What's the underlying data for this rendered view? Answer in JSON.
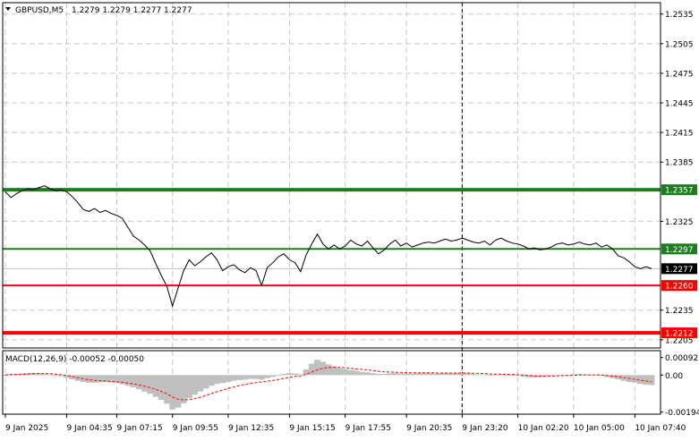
{
  "header": {
    "symbol_label": "GBPUSD,M5",
    "ohlc_label": "1.2279 1.2279 1.2277 1.2277"
  },
  "macd_panel": {
    "label": "MACD(12,26,9) -0.00052 -0.00050"
  },
  "colors": {
    "background": "#ffffff",
    "price_line": "#000000",
    "grid": "#c8c8c8",
    "green_level": "#1e7d1e",
    "red_level": "#ff0000",
    "histogram": "#c0c0c0",
    "signal_line": "#ff0000"
  },
  "chart_data": [
    {
      "type": "line",
      "title": "GBPUSD,M5",
      "y_ticks": [
        "1.2535",
        "1.2505",
        "1.2475",
        "1.2445",
        "1.2415",
        "1.2385",
        "1.2325",
        "1.2235",
        "1.2205"
      ],
      "ylim": [
        1.2203,
        1.2542
      ],
      "grid": "dashed",
      "x_ticks": [
        {
          "label": "9 Jan 2025",
          "i": 0
        },
        {
          "label": "9 Jan 04:35",
          "i": 11
        },
        {
          "label": "9 Jan 07:15",
          "i": 20
        },
        {
          "label": "9 Jan 09:55",
          "i": 30
        },
        {
          "label": "9 Jan 12:35",
          "i": 40
        },
        {
          "label": "9 Jan 15:15",
          "i": 51
        },
        {
          "label": "9 Jan 17:55",
          "i": 61
        },
        {
          "label": "9 Jan 20:35",
          "i": 72
        },
        {
          "label": "9 Jan 23:20",
          "i": 82
        },
        {
          "label": "10 Jan 02:20",
          "i": 92
        },
        {
          "label": "10 Jan 05:00",
          "i": 102
        },
        {
          "label": "10 Jan 07:40",
          "i": 113
        }
      ],
      "vline_at_i": 82,
      "levels": [
        {
          "value": 1.2357,
          "label": "1.2357",
          "color": "#1e7d1e",
          "thick": true
        },
        {
          "value": 1.2297,
          "label": "1.2297",
          "color": "#1e7d1e",
          "thick": false
        },
        {
          "value": 1.226,
          "label": "1.2260",
          "color": "#ff0000",
          "thick": false
        },
        {
          "value": 1.2212,
          "label": "1.2212",
          "color": "#ff0000",
          "thick": true
        }
      ],
      "current": {
        "value": 1.2277,
        "label": "1.2277"
      },
      "series": [
        {
          "values": [
            1.2355,
            1.2349,
            1.2353,
            1.2356,
            1.2358,
            1.2357,
            1.2359,
            1.2361,
            1.2358,
            1.2356,
            1.2357,
            1.2355,
            1.235,
            1.2344,
            1.2337,
            1.2335,
            1.2338,
            1.2334,
            1.2336,
            1.2333,
            1.2331,
            1.2328,
            1.2319,
            1.231,
            1.2306,
            1.2301,
            1.2295,
            1.2282,
            1.227,
            1.2259,
            1.2239,
            1.2257,
            1.2275,
            1.2286,
            1.228,
            1.2284,
            1.2289,
            1.2293,
            1.2286,
            1.2275,
            1.2279,
            1.2281,
            1.2276,
            1.2273,
            1.2278,
            1.2275,
            1.226,
            1.2278,
            1.2283,
            1.2289,
            1.2292,
            1.2286,
            1.2283,
            1.2274,
            1.2291,
            1.2302,
            1.2312,
            1.2302,
            1.2297,
            1.2301,
            1.2297,
            1.23,
            1.2306,
            1.2302,
            1.23,
            1.2305,
            1.2298,
            1.2292,
            1.2296,
            1.2302,
            1.2306,
            1.23,
            1.2303,
            1.2299,
            1.2301,
            1.2303,
            1.2304,
            1.2303,
            1.2305,
            1.2307,
            1.2305,
            1.2306,
            1.2308,
            1.2306,
            1.2304,
            1.2303,
            1.2305,
            1.2301,
            1.2306,
            1.2308,
            1.2305,
            1.2303,
            1.2302,
            1.23,
            1.2297,
            1.2298,
            1.2296,
            1.2297,
            1.2299,
            1.2302,
            1.2303,
            1.2301,
            1.2302,
            1.2304,
            1.2302,
            1.2301,
            1.2303,
            1.2299,
            1.2301,
            1.2297,
            1.229,
            1.2288,
            1.2284,
            1.2279,
            1.2277,
            1.2279,
            1.2277
          ]
        }
      ]
    },
    {
      "type": "bar",
      "title": "MACD(12,26,9)",
      "y_ticks": [
        "0.00092",
        "0.00",
        "-0.00194"
      ],
      "ylim": [
        -0.002,
        0.001
      ],
      "zero_line": true,
      "series": [
        {
          "name": "MACD",
          "values": [
            2e-05,
            6e-05,
            6e-05,
            8e-05,
            0.0001,
            0.00012,
            0.0001,
            6e-05,
            4e-05,
            0.0,
            -6e-05,
            -0.00014,
            -0.00022,
            -0.0003,
            -0.00036,
            -0.0004,
            -0.0004,
            -0.00038,
            -0.00036,
            -0.00038,
            -0.00042,
            -0.00048,
            -0.00056,
            -0.00064,
            -0.00074,
            -0.00086,
            -0.00098,
            -0.00114,
            -0.0013,
            -0.0015,
            -0.0018,
            -0.0017,
            -0.00148,
            -0.0012,
            -0.00102,
            -0.00086,
            -0.0007,
            -0.00056,
            -0.00046,
            -0.00042,
            -0.00036,
            -0.0003,
            -0.00026,
            -0.00024,
            -0.0002,
            -0.0002,
            -0.00024,
            -0.00016,
            -0.0001,
            -2e-05,
            6e-05,
            0.0001,
            8e-05,
            4e-05,
            0.0003,
            0.0006,
            0.0008,
            0.0007,
            0.00056,
            0.00046,
            0.00036,
            0.0003,
            0.00026,
            0.00022,
            0.00016,
            0.00014,
            0.0001,
            6e-05,
            6e-05,
            0.0001,
            0.00012,
            0.0001,
            0.0001,
            8e-05,
            0.0001,
            0.00012,
            0.00012,
            0.0001,
            0.0001,
            0.00012,
            0.0001,
            0.0001,
            0.00012,
            0.0001,
            6e-05,
            4e-05,
            4e-05,
            0.0,
            2e-05,
            4e-05,
            2e-05,
            -2e-05,
            -4e-05,
            -8e-05,
            -0.00012,
            -0.00012,
            -0.0001,
            -8e-05,
            -4e-05,
            0.0,
            2e-05,
            2e-05,
            4e-05,
            6e-05,
            4e-05,
            2e-05,
            2e-05,
            -4e-05,
            -0.0001,
            -0.00016,
            -0.00022,
            -0.0003,
            -0.00036,
            -0.0004,
            -0.00046,
            -0.0005,
            -0.00052
          ]
        },
        {
          "name": "Signal",
          "values": [
            0.0,
            2e-05,
            3e-05,
            4e-05,
            6e-05,
            7e-05,
            8e-05,
            8e-05,
            7e-05,
            5e-05,
            2e-05,
            -2e-05,
            -7e-05,
            -0.00013,
            -0.00019,
            -0.00024,
            -0.00028,
            -0.0003,
            -0.00031,
            -0.00033,
            -0.00035,
            -0.00038,
            -0.00042,
            -0.00046,
            -0.00052,
            -0.00058,
            -0.00066,
            -0.00075,
            -0.00086,
            -0.00098,
            -0.00115,
            -0.00126,
            -0.0013,
            -0.00128,
            -0.00123,
            -0.00116,
            -0.00107,
            -0.00097,
            -0.00087,
            -0.00078,
            -0.0007,
            -0.00062,
            -0.00055,
            -0.00049,
            -0.00043,
            -0.00039,
            -0.00036,
            -0.00032,
            -0.00028,
            -0.00023,
            -0.00017,
            -0.00011,
            -7e-05,
            -4e-05,
            4e-05,
            0.00015,
            0.00028,
            0.00036,
            0.0004,
            0.00041,
            0.0004,
            0.00038,
            0.00036,
            0.00033,
            0.0003,
            0.00027,
            0.00024,
            0.0002,
            0.00017,
            0.00016,
            0.00015,
            0.00014,
            0.00013,
            0.00012,
            0.00012,
            0.00012,
            0.00012,
            0.00012,
            0.00011,
            0.00011,
            0.00011,
            0.00011,
            0.00011,
            0.00011,
            0.0001,
            9e-05,
            8e-05,
            6e-05,
            5e-05,
            5e-05,
            4e-05,
            3e-05,
            2e-05,
            0.0,
            -2e-05,
            -4e-05,
            -5e-05,
            -6e-05,
            -5e-05,
            -4e-05,
            -3e-05,
            -2e-05,
            -1e-05,
            0.0,
            1e-05,
            1e-05,
            1e-05,
            0.0,
            -2e-05,
            -5e-05,
            -8e-05,
            -0.00013,
            -0.00017,
            -0.00022,
            -0.00027,
            -0.00031,
            -0.00035
          ]
        }
      ]
    }
  ]
}
